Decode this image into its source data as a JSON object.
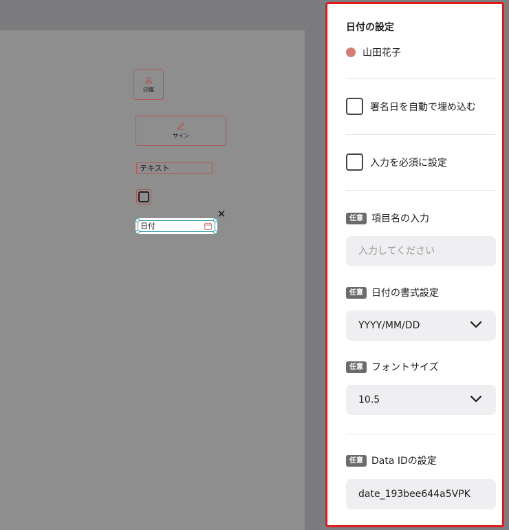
{
  "document": {
    "fields": {
      "seal_label": "印鑑",
      "sign_label": "サイン",
      "text_label": "テキスト",
      "date_label": "日付",
      "delete_icon": "close-icon"
    }
  },
  "panel": {
    "title": "日付の設定",
    "assignee": {
      "name": "山田花子",
      "color": "#d77c74"
    },
    "auto_embed_label": "署名日を自動で埋め込む",
    "required_label": "入力を必須に設定",
    "optional_badge": "任意",
    "item_name": {
      "label": "項目名の入力",
      "placeholder": "入力してください"
    },
    "date_format": {
      "label": "日付の書式設定",
      "value": "YYYY/MM/DD"
    },
    "font_size": {
      "label": "フォントサイズ",
      "value": "10.5"
    },
    "data_id": {
      "label": "Data IDの設定",
      "value": "date_193bee644a5VPK"
    }
  },
  "colors": {
    "accent_border": "#e0191b",
    "selection": "#2b9aa8",
    "field_border": "#b05a55"
  }
}
